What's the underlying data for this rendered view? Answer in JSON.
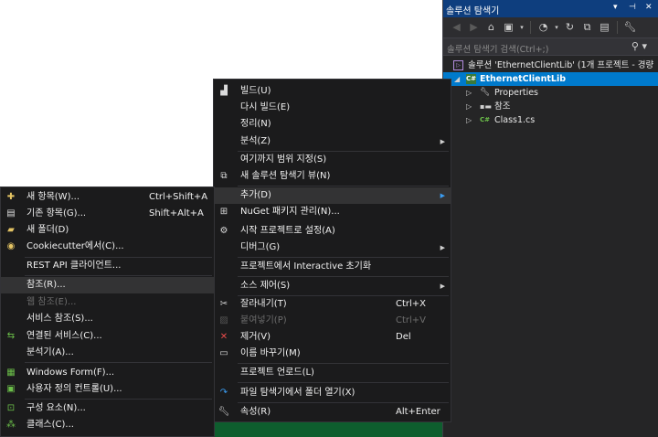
{
  "solution_explorer": {
    "title": "솔루션 탐색기",
    "search_placeholder": "솔루션 탐색기 검색(Ctrl+;)",
    "tree": [
      {
        "label": "솔루션 'EthernetClientLib' (1개 프로젝트 - 경량",
        "icon": "solution-icon"
      },
      {
        "label": "EthernetClientLib",
        "icon": "csharp-project-icon",
        "selected": true
      },
      {
        "label": "Properties",
        "icon": "wrench-icon"
      },
      {
        "label": "참조",
        "icon": "references-icon"
      },
      {
        "label": "Class1.cs",
        "icon": "csharp-file-icon"
      }
    ]
  },
  "context_menu": {
    "items": [
      {
        "label": "빌드(U)",
        "icon": "build-icon"
      },
      {
        "label": "다시 빌드(E)"
      },
      {
        "label": "정리(N)"
      },
      {
        "label": "분석(Z)",
        "submenu": true
      },
      {
        "label": "여기까지 범위 지정(S)"
      },
      {
        "label": "새 솔루션 탐색기 뷰(N)",
        "icon": "new-view-icon"
      },
      {
        "label": "추가(D)",
        "submenu": true,
        "highlighted": true
      },
      {
        "label": "NuGet 패키지 관리(N)...",
        "icon": "nuget-icon"
      },
      {
        "label": "시작 프로젝트로 설정(A)",
        "icon": "gear-icon"
      },
      {
        "label": "디버그(G)",
        "submenu": true
      },
      {
        "label": "프로젝트에서 Interactive 초기화"
      },
      {
        "label": "소스 제어(S)",
        "submenu": true
      },
      {
        "label": "잘라내기(T)",
        "shortcut": "Ctrl+X",
        "icon": "scissors-icon"
      },
      {
        "label": "붙여넣기(P)",
        "shortcut": "Ctrl+V",
        "icon": "paste-icon",
        "disabled": true
      },
      {
        "label": "제거(V)",
        "shortcut": "Del",
        "icon": "delete-icon"
      },
      {
        "label": "이름 바꾸기(M)",
        "icon": "rename-icon"
      },
      {
        "label": "프로젝트 언로드(L)"
      },
      {
        "label": "파일 탐색기에서 폴더 열기(X)",
        "icon": "refresh-arrow-icon"
      },
      {
        "label": "속성(R)",
        "shortcut": "Alt+Enter",
        "icon": "wrench-icon"
      }
    ]
  },
  "add_submenu": {
    "items": [
      {
        "label": "새 항목(W)...",
        "shortcut": "Ctrl+Shift+A",
        "icon": "new-item-icon"
      },
      {
        "label": "기존 항목(G)...",
        "shortcut": "Shift+Alt+A",
        "icon": "existing-item-icon"
      },
      {
        "label": "새 폴더(D)",
        "icon": "new-folder-icon"
      },
      {
        "label": "Cookiecutter에서(C)...",
        "icon": "cookiecutter-icon"
      },
      {
        "label": "REST API 클라이언트..."
      },
      {
        "label": "참조(R)...",
        "highlighted": true
      },
      {
        "label": "웹 참조(E)...",
        "disabled": true
      },
      {
        "label": "서비스 참조(S)..."
      },
      {
        "label": "연결된 서비스(C)...",
        "icon": "connected-service-icon"
      },
      {
        "label": "분석기(A)..."
      },
      {
        "label": "Windows Form(F)...",
        "icon": "windows-form-icon"
      },
      {
        "label": "사용자 정의 컨트롤(U)...",
        "icon": "user-control-icon"
      },
      {
        "label": "구성 요소(N)...",
        "icon": "component-icon"
      },
      {
        "label": "클래스(C)...",
        "icon": "class-icon"
      }
    ]
  }
}
